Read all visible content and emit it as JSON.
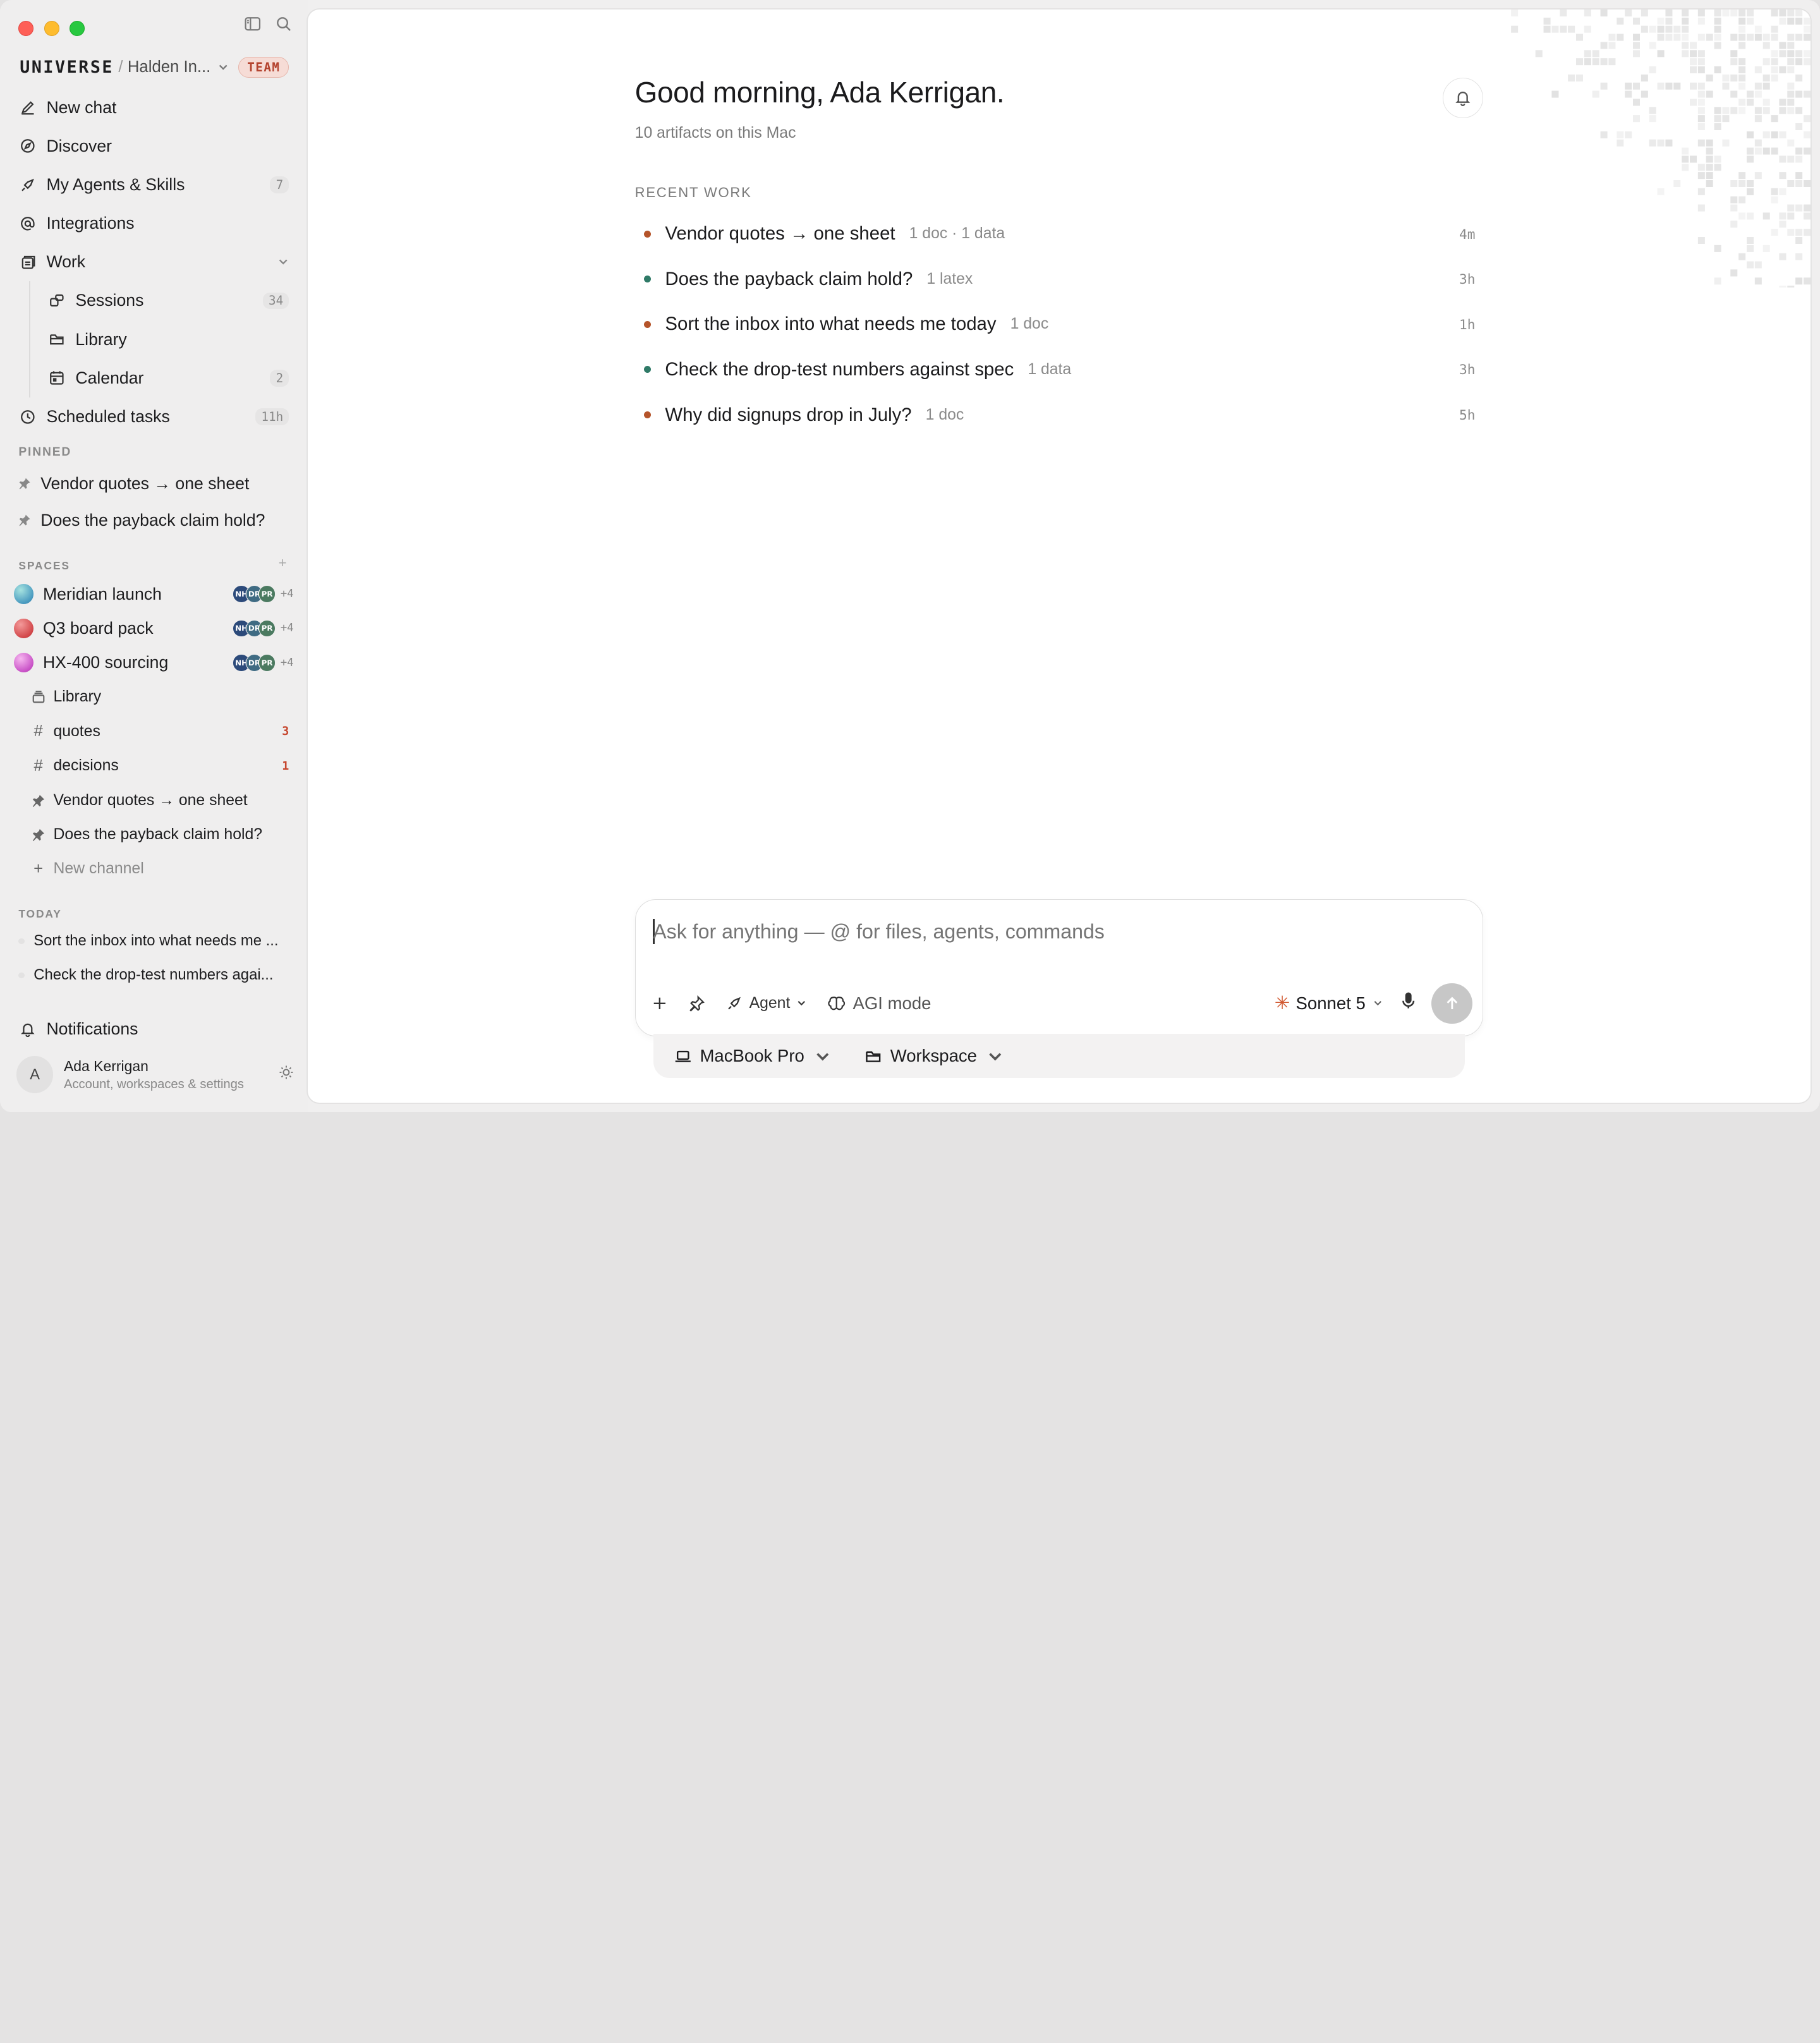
{
  "app": {
    "brand": "UNIVERSE",
    "workspace": "Halden In...",
    "plan_badge": "TEAM"
  },
  "nav": {
    "new_chat": "New chat",
    "discover": "Discover",
    "agents": "My Agents & Skills",
    "agents_count": "7",
    "integrations": "Integrations",
    "work": "Work",
    "sessions": "Sessions",
    "sessions_count": "34",
    "library": "Library",
    "calendar": "Calendar",
    "calendar_count": "2",
    "scheduled": "Scheduled tasks",
    "scheduled_count": "11h"
  },
  "pinned": {
    "label": "PINNED",
    "items": [
      "Vendor quotes → one sheet",
      "Does the payback claim hold?"
    ]
  },
  "spaces": {
    "label": "SPACES",
    "items": [
      {
        "name": "Meridian launch",
        "avatars": [
          "NH",
          "DR",
          "PR"
        ],
        "more": "+4"
      },
      {
        "name": "Q3 board pack",
        "avatars": [
          "NH",
          "DR",
          "PR"
        ],
        "more": "+4"
      },
      {
        "name": "HX-400 sourcing",
        "avatars": [
          "NH",
          "DR",
          "PR"
        ],
        "more": "+4"
      }
    ],
    "sub": {
      "library": "Library",
      "quotes": "quotes",
      "quotes_badge": "3",
      "decisions": "decisions",
      "decisions_badge": "1",
      "pin1": "Vendor quotes → one sheet",
      "pin2": "Does the payback claim hold?",
      "new_channel": "New channel"
    }
  },
  "today": {
    "label": "TODAY",
    "items": [
      "Sort the inbox into what needs me ...",
      "Check the drop-test numbers agai..."
    ]
  },
  "notifications": "Notifications",
  "user": {
    "initial": "A",
    "name": "Ada Kerrigan",
    "subtitle": "Account, workspaces & settings"
  },
  "main": {
    "greeting": "Good morning, Ada Kerrigan.",
    "artifacts": "10 artifacts on this Mac",
    "recent_label": "RECENT WORK",
    "recent": [
      {
        "title": "Vendor quotes → one sheet",
        "meta": "1 doc · 1 data",
        "time": "4m",
        "dot": "#b5542a"
      },
      {
        "title": "Does the payback claim hold?",
        "meta": "1 latex",
        "time": "3h",
        "dot": "#2f7a67"
      },
      {
        "title": "Sort the inbox into what needs me today",
        "meta": "1 doc",
        "time": "1h",
        "dot": "#b5542a"
      },
      {
        "title": "Check the drop-test numbers against spec",
        "meta": "1 data",
        "time": "3h",
        "dot": "#2f7a67"
      },
      {
        "title": "Why did signups drop in July?",
        "meta": "1 doc",
        "time": "5h",
        "dot": "#b5542a"
      }
    ]
  },
  "composer": {
    "placeholder": "Ask for anything — @ for files, agents, commands",
    "agent": "Agent",
    "agi": "AGI mode",
    "model": "Sonnet 5"
  },
  "device": {
    "machine": "MacBook Pro",
    "folder": "Workspace"
  },
  "colors": {
    "accent_orange": "#b5542a",
    "accent_teal": "#2f7a67",
    "team_badge": "#b4432f"
  }
}
